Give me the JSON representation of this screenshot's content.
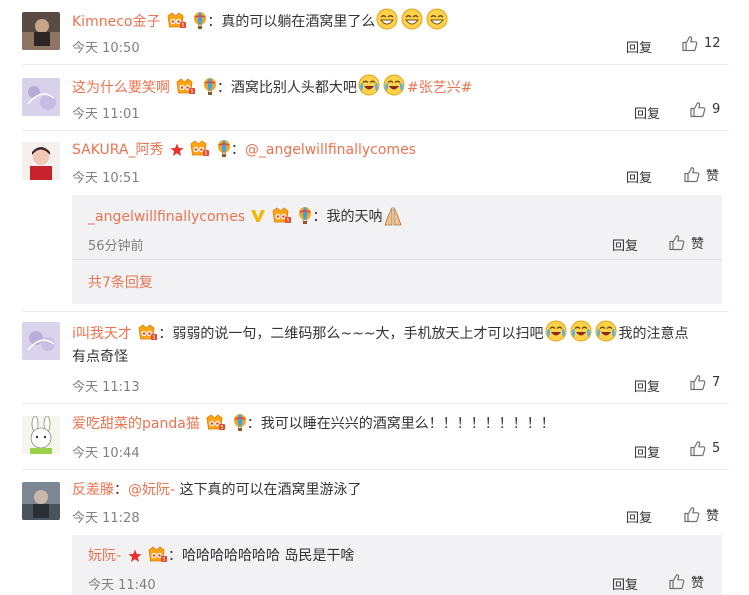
{
  "comments": [
    {
      "name": "Kimneco金子",
      "sep": "：",
      "text": "真的可以躺在酒窝里了么",
      "time": "今天 10:50",
      "reply": "回复",
      "likes": "12"
    },
    {
      "name": "这为什么要笑啊",
      "sep": "：",
      "text": "酒窝比别人头都大吧",
      "topic": "#张艺兴#",
      "time": "今天 11:01",
      "reply": "回复",
      "likes": "9"
    },
    {
      "name": "SAKURA_阿秀",
      "sep": "：",
      "mention": "@_angelwillfinallycomes",
      "time": "今天 10:51",
      "reply": "回复",
      "likes": "赞"
    },
    {
      "name": "i叫我天才",
      "sep": "：",
      "text": "弱弱的说一句，二维码那么~~~大，手机放天上才可以扫吧",
      "text_tail": "我的注意点",
      "text2": "有点奇怪",
      "time": "今天 11:13",
      "reply": "回复",
      "likes": "7"
    },
    {
      "name": "爱吃甜菜的panda猫",
      "sep": "：",
      "text": "我可以睡在兴兴的酒窝里么！！！！！！！！！",
      "time": "今天 10:44",
      "reply": "回复",
      "likes": "5"
    },
    {
      "name": "反差滕",
      "sep": "：",
      "mention": "@妧阮-",
      "text": "这下真的可以在酒窝里游泳了",
      "time": "今天 11:28",
      "reply": "回复",
      "likes": "赞"
    }
  ],
  "sub_replies": [
    {
      "name": "_angelwillfinallycomes",
      "sep": "：",
      "text": "我的天呐",
      "time": "56分钟前",
      "reply": "回复",
      "likes": "赞"
    },
    {
      "name": "妧阮-",
      "sep": "：",
      "text": "哈哈哈哈哈哈哈 岛民是干啥",
      "time": "今天 11:40",
      "reply": "回复",
      "likes": "赞"
    }
  ],
  "more_replies": "共7条回复",
  "colors": {
    "name": "#eb7350",
    "text": "#333333",
    "time": "#808080",
    "reply_bg": "#f2f2f5"
  }
}
